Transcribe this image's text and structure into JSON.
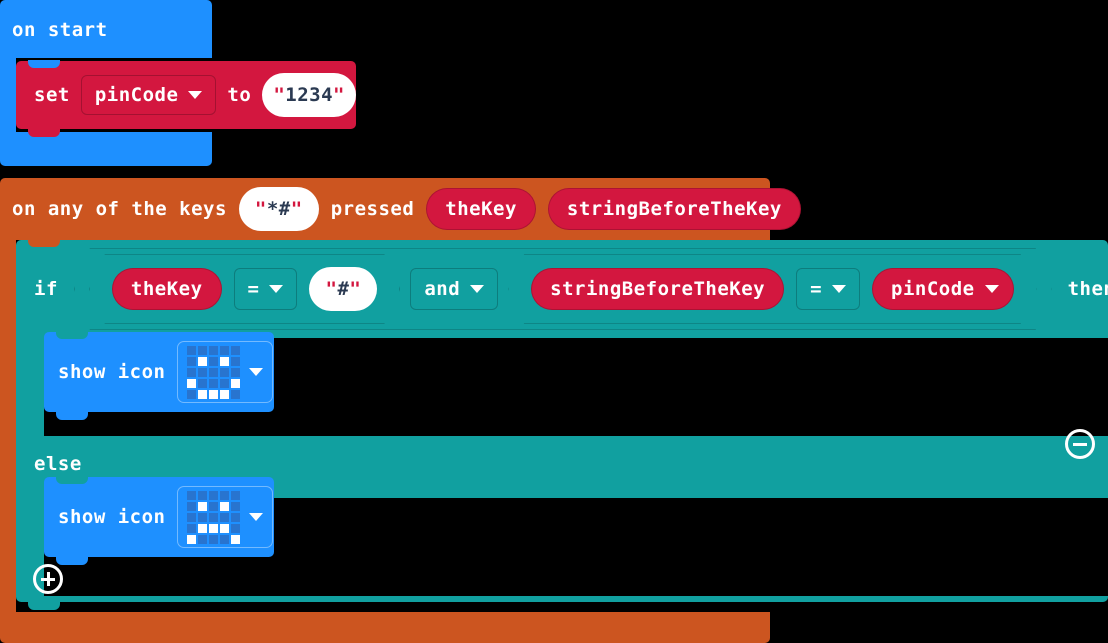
{
  "program": {
    "editor": "makecode-blocks",
    "colors": {
      "event_blue": "#1e90ff",
      "variables_red": "#d3173f",
      "event_orange": "#cc5520",
      "logic_teal": "#11a0a0",
      "background": "#000000",
      "led_off": "#2874cf",
      "led_on": "#ffffff"
    }
  },
  "on_start": {
    "label": "on start",
    "set_statement": {
      "set_label": "set",
      "variable": "pinCode",
      "to_label": "to",
      "value": "\"1234\"",
      "value_quote_open": "\"",
      "value_text": "1234",
      "value_quote_close": "\""
    }
  },
  "on_keys_event": {
    "label_prefix": "on any of the keys",
    "keys_value": "\"*#\"",
    "keys_quote_open": "\"",
    "keys_text": "*#",
    "keys_quote_close": "\"",
    "label_suffix": "pressed",
    "params": [
      {
        "name": "theKey"
      },
      {
        "name": "stringBeforeTheKey"
      }
    ]
  },
  "if_block": {
    "if_label": "if",
    "then_label": "then",
    "else_label": "else",
    "condition": {
      "operator": "and",
      "left": {
        "operand_a": "theKey",
        "comparator": "=",
        "operand_b": "\"#\"",
        "operand_b_quote_open": "\"",
        "operand_b_text": "#",
        "operand_b_quote_close": "\""
      },
      "right": {
        "operand_a": "stringBeforeTheKey",
        "comparator": "=",
        "operand_b": "pinCode"
      }
    },
    "then_body": [
      {
        "label": "show icon",
        "icon_name": "Happy",
        "led_matrix": [
          [
            0,
            0,
            0,
            0,
            0
          ],
          [
            0,
            1,
            0,
            1,
            0
          ],
          [
            0,
            0,
            0,
            0,
            0
          ],
          [
            1,
            0,
            0,
            0,
            1
          ],
          [
            0,
            1,
            1,
            1,
            0
          ]
        ]
      }
    ],
    "else_body": [
      {
        "label": "show icon",
        "icon_name": "Sad",
        "led_matrix": [
          [
            0,
            0,
            0,
            0,
            0
          ],
          [
            0,
            1,
            0,
            1,
            0
          ],
          [
            0,
            0,
            0,
            0,
            0
          ],
          [
            0,
            1,
            1,
            1,
            0
          ],
          [
            1,
            0,
            0,
            0,
            1
          ]
        ]
      }
    ],
    "mutator": {
      "remove_button": "minus-icon",
      "add_button": "plus-icon"
    }
  }
}
